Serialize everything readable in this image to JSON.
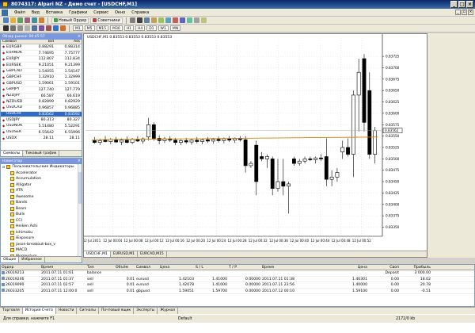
{
  "window": {
    "title": "8074317: Alpari NZ - Демо счет - [USDCHF,M1]"
  },
  "menu": [
    "Файл",
    "Вид",
    "Вставка",
    "Графики",
    "Сервис",
    "Окно",
    "Справка"
  ],
  "toolbar": {
    "new_order": "Новый Ордер",
    "advisors": "Советники",
    "timeframes": [
      "M1",
      "M5",
      "M15",
      "M30",
      "H1",
      "H4",
      "D1",
      "W1",
      "MN"
    ]
  },
  "market_watch": {
    "title": "Обзор рынка: 00:45:57",
    "columns": [
      "Символ",
      "Bid",
      "Ask"
    ],
    "rows": [
      {
        "symbol": "EURGBP",
        "bid": "0.88291",
        "ask": "0.88314",
        "dir": "down"
      },
      {
        "symbol": "EURNOK",
        "bid": "7.74695",
        "ask": "7.75777",
        "dir": "down"
      },
      {
        "symbol": "EURJPY",
        "bid": "112.807",
        "ask": "112.834",
        "dir": "down"
      },
      {
        "symbol": "EURSEK",
        "bid": "9.21051",
        "ask": "9.21399",
        "dir": "down"
      },
      {
        "symbol": "GBPCAD",
        "bid": "1.54055",
        "ask": "1.54147",
        "dir": "down"
      },
      {
        "symbol": "GBPCHF",
        "bid": "1.32910",
        "ask": "1.32999",
        "dir": "down"
      },
      {
        "symbol": "GBPUSD",
        "bid": "1.59061",
        "ask": "1.59101",
        "dir": "down"
      },
      {
        "symbol": "GBPJPY",
        "bid": "127.740",
        "ask": "127.779",
        "dir": "down"
      },
      {
        "symbol": "NZDJPY",
        "bid": "66.587",
        "ask": "66.619",
        "dir": "down"
      },
      {
        "symbol": "NZDUSD",
        "bid": "0.82899",
        "ask": "0.82929",
        "dir": "down"
      },
      {
        "symbol": "USDCAD",
        "bid": "0.96857",
        "ask": "0.96885",
        "dir": "down"
      },
      {
        "symbol": "USDCHF",
        "bid": "0.83562",
        "ask": "0.83592",
        "dir": "up",
        "selected": true
      },
      {
        "symbol": "USDJPY",
        "bid": "80.313",
        "ask": "80.327",
        "dir": "down"
      },
      {
        "symbol": "USDNOK",
        "bid": "5.51480",
        "ask": "5.52291",
        "dir": "down"
      },
      {
        "symbol": "USDSEK",
        "bid": "6.55642",
        "ask": "6.55996",
        "dir": "down"
      },
      {
        "symbol": "USDX",
        "bid": "28.11",
        "ask": "28.11",
        "dir": "down"
      }
    ],
    "tabs": [
      "Символы",
      "Тиковый график"
    ]
  },
  "navigator": {
    "title": "Навигатор",
    "root": "Пользовательские Индикаторы",
    "items": [
      "Accelerator",
      "Accumulation",
      "Alligator",
      "ATR",
      "Awesome",
      "Bands",
      "Bears",
      "Bulls",
      "CCI",
      "Heiken Ashi",
      "Ichimoku",
      "iExposure",
      "jason-breakout-box_v",
      "MACD",
      "Momentum"
    ],
    "tabs": [
      "Общие",
      "Избранное"
    ]
  },
  "chart": {
    "label": "USDCHF,M1 0.83553 0.83553 0.83553 0.83553",
    "tabs": [
      "USDCHF,M1",
      "EURUSD,M1",
      "EURCAD,M15"
    ],
    "current_price": "0.83562"
  },
  "chart_data": {
    "type": "candlestick",
    "symbol": "USDCHF",
    "timeframe": "M1",
    "ylim": [
      0.8333,
      0.8376
    ],
    "y_ticks": [
      "0.83725",
      "0.83700",
      "0.83675",
      "0.83650",
      "0.83625",
      "0.83600",
      "0.83575",
      "0.83550",
      "0.83525",
      "0.83500",
      "0.83475",
      "0.83450",
      "0.83425",
      "0.83400",
      "0.83375",
      "0.83350"
    ],
    "x_ticks": [
      "12 Jul 2011",
      "12 Jul 00:04",
      "12 Jul 00:08",
      "12 Jul 00:12",
      "12 Jul 00:16",
      "12 Jul 00:20",
      "12 Jul 00:24",
      "12 Jul 00:28",
      "12 Jul 00:32",
      "12 Jul 00:36",
      "12 Jul 00:40",
      "12 Jul 00:44",
      "12 Jul 00:48",
      "12 Jul 00:52"
    ],
    "candles": [
      {
        "o": 0.8354,
        "h": 0.83548,
        "l": 0.83533,
        "c": 0.83536
      },
      {
        "o": 0.83536,
        "h": 0.83544,
        "l": 0.8353,
        "c": 0.8354
      },
      {
        "o": 0.83541,
        "h": 0.8355,
        "l": 0.83536,
        "c": 0.83538
      },
      {
        "o": 0.83538,
        "h": 0.83546,
        "l": 0.83532,
        "c": 0.83542
      },
      {
        "o": 0.83542,
        "h": 0.83548,
        "l": 0.83535,
        "c": 0.83537
      },
      {
        "o": 0.83537,
        "h": 0.83545,
        "l": 0.8353,
        "c": 0.83541
      },
      {
        "o": 0.83541,
        "h": 0.83549,
        "l": 0.83534,
        "c": 0.83536
      },
      {
        "o": 0.83536,
        "h": 0.83546,
        "l": 0.83532,
        "c": 0.83543
      },
      {
        "o": 0.83543,
        "h": 0.8355,
        "l": 0.83537,
        "c": 0.83539
      },
      {
        "o": 0.83539,
        "h": 0.83547,
        "l": 0.83533,
        "c": 0.83544
      },
      {
        "o": 0.83548,
        "h": 0.8359,
        "l": 0.8354,
        "c": 0.83575
      },
      {
        "o": 0.83575,
        "h": 0.8358,
        "l": 0.8354,
        "c": 0.83545
      },
      {
        "o": 0.83545,
        "h": 0.83552,
        "l": 0.83532,
        "c": 0.8354
      },
      {
        "o": 0.8354,
        "h": 0.83548,
        "l": 0.83535,
        "c": 0.83544
      },
      {
        "o": 0.83544,
        "h": 0.8355,
        "l": 0.83537,
        "c": 0.83541
      },
      {
        "o": 0.83541,
        "h": 0.83546,
        "l": 0.8353,
        "c": 0.83536
      },
      {
        "o": 0.83536,
        "h": 0.83543,
        "l": 0.8353,
        "c": 0.8354
      },
      {
        "o": 0.8354,
        "h": 0.83546,
        "l": 0.83533,
        "c": 0.83537
      },
      {
        "o": 0.83537,
        "h": 0.83544,
        "l": 0.83531,
        "c": 0.83541
      },
      {
        "o": 0.83541,
        "h": 0.83548,
        "l": 0.83534,
        "c": 0.83538
      },
      {
        "o": 0.83538,
        "h": 0.83545,
        "l": 0.83532,
        "c": 0.83542
      },
      {
        "o": 0.83542,
        "h": 0.83548,
        "l": 0.83535,
        "c": 0.83539
      },
      {
        "o": 0.83539,
        "h": 0.83546,
        "l": 0.83533,
        "c": 0.83543
      },
      {
        "o": 0.83543,
        "h": 0.83549,
        "l": 0.83536,
        "c": 0.8354
      },
      {
        "o": 0.8354,
        "h": 0.83547,
        "l": 0.83534,
        "c": 0.83544
      },
      {
        "o": 0.83544,
        "h": 0.8355,
        "l": 0.83537,
        "c": 0.83541
      },
      {
        "o": 0.83541,
        "h": 0.83547,
        "l": 0.83535,
        "c": 0.83545
      },
      {
        "o": 0.83545,
        "h": 0.8355,
        "l": 0.83538,
        "c": 0.83542
      },
      {
        "o": 0.83542,
        "h": 0.8355,
        "l": 0.8347,
        "c": 0.83485
      },
      {
        "o": 0.83485,
        "h": 0.83495,
        "l": 0.8348,
        "c": 0.8349
      },
      {
        "o": 0.8353,
        "h": 0.8354,
        "l": 0.8342,
        "c": 0.8345
      },
      {
        "o": 0.83505,
        "h": 0.83515,
        "l": 0.83495,
        "c": 0.835
      },
      {
        "o": 0.835,
        "h": 0.8351,
        "l": 0.8348,
        "c": 0.83505
      },
      {
        "o": 0.835,
        "h": 0.83505,
        "l": 0.8342,
        "c": 0.83435
      },
      {
        "o": 0.83435,
        "h": 0.835,
        "l": 0.83428,
        "c": 0.8345
      },
      {
        "o": 0.8345,
        "h": 0.835,
        "l": 0.8342,
        "c": 0.8344
      },
      {
        "o": 0.8344,
        "h": 0.8345,
        "l": 0.8338,
        "c": 0.83445
      },
      {
        "o": 0.835,
        "h": 0.83505,
        "l": 0.83485,
        "c": 0.8349
      },
      {
        "o": 0.8349,
        "h": 0.835,
        "l": 0.83485,
        "c": 0.83495
      },
      {
        "o": 0.83495,
        "h": 0.83505,
        "l": 0.8349,
        "c": 0.835
      },
      {
        "o": 0.835,
        "h": 0.83505,
        "l": 0.83495,
        "c": 0.83498
      },
      {
        "o": 0.83498,
        "h": 0.83505,
        "l": 0.8349,
        "c": 0.83502
      },
      {
        "o": 0.83502,
        "h": 0.8351,
        "l": 0.83495,
        "c": 0.835
      },
      {
        "o": 0.83505,
        "h": 0.83545,
        "l": 0.8344,
        "c": 0.83455
      },
      {
        "o": 0.83455,
        "h": 0.83475,
        "l": 0.8344,
        "c": 0.8346
      },
      {
        "o": 0.8346,
        "h": 0.8348,
        "l": 0.8345,
        "c": 0.8347
      },
      {
        "o": 0.83515,
        "h": 0.8354,
        "l": 0.835,
        "c": 0.83525
      },
      {
        "o": 0.83525,
        "h": 0.83545,
        "l": 0.83505,
        "c": 0.8351
      },
      {
        "o": 0.8351,
        "h": 0.8365,
        "l": 0.8346,
        "c": 0.8364
      },
      {
        "o": 0.8364,
        "h": 0.8372,
        "l": 0.8356,
        "c": 0.8369
      },
      {
        "o": 0.8372,
        "h": 0.8373,
        "l": 0.8356,
        "c": 0.8358
      },
      {
        "o": 0.8365,
        "h": 0.8369,
        "l": 0.835,
        "c": 0.8351
      },
      {
        "o": 0.8351,
        "h": 0.8357,
        "l": 0.8349,
        "c": 0.83562
      }
    ],
    "ma": {
      "color": "#d58000",
      "start": 0.83542,
      "end": 0.83548
    },
    "grid": true
  },
  "terminal": {
    "columns": [
      "Ордер",
      "Время",
      "Тип",
      "Объём",
      "Символ",
      "Цена",
      "S / L",
      "T / P",
      "Время",
      "Цена",
      "Своп",
      "Прибыль"
    ],
    "rows": [
      {
        "order": "26019213",
        "open": "2011.07.11 01:01",
        "type": "balance",
        "volume": "",
        "symbol": "",
        "price": "",
        "sl": "",
        "tp": "",
        "close_time": "",
        "close_price": "",
        "swap": "Deposit",
        "profit": "3 000.00"
      },
      {
        "order": "26019246",
        "open": "2011.07.11 01:37",
        "type": "sell",
        "volume": "0.01",
        "symbol": "eurusd",
        "price": "1.42103",
        "sl": "1.41000",
        "tp": "0.00000",
        "close_time": "2011.07.11 01:38",
        "close_price": "1.40301",
        "swap": "0.00",
        "profit": "18.02"
      },
      {
        "order": "26019090",
        "open": "2011.07.11 02:57",
        "type": "sell",
        "volume": "0.01",
        "symbol": "eurusd",
        "price": "1.42078",
        "sl": "1.41000",
        "tp": "0.00000",
        "close_time": "2011.07.11 23:56",
        "close_price": "1.40000",
        "swap": "0.00",
        "profit": "20.78"
      },
      {
        "order": "26033205",
        "open": "2011.07.11 12:00:0",
        "type": "sell",
        "volume": "0.01",
        "symbol": "gbpusd",
        "price": "1.59051",
        "sl": "1.59700",
        "tp": "0.00000",
        "close_time": "2011.07.12 00:10",
        "close_price": "1.59100",
        "swap": "0.00",
        "profit": "-0.51"
      }
    ],
    "tabs": [
      "Торговля",
      "История Счета",
      "Новости",
      "Сигналы",
      "Почтовый ящик",
      "Эксперты",
      "Журнал"
    ],
    "active_tab": "История Счета"
  },
  "status": {
    "help": "Для справки, нажмите F1",
    "profile": "Default",
    "traffic": "2172/0 kb"
  }
}
